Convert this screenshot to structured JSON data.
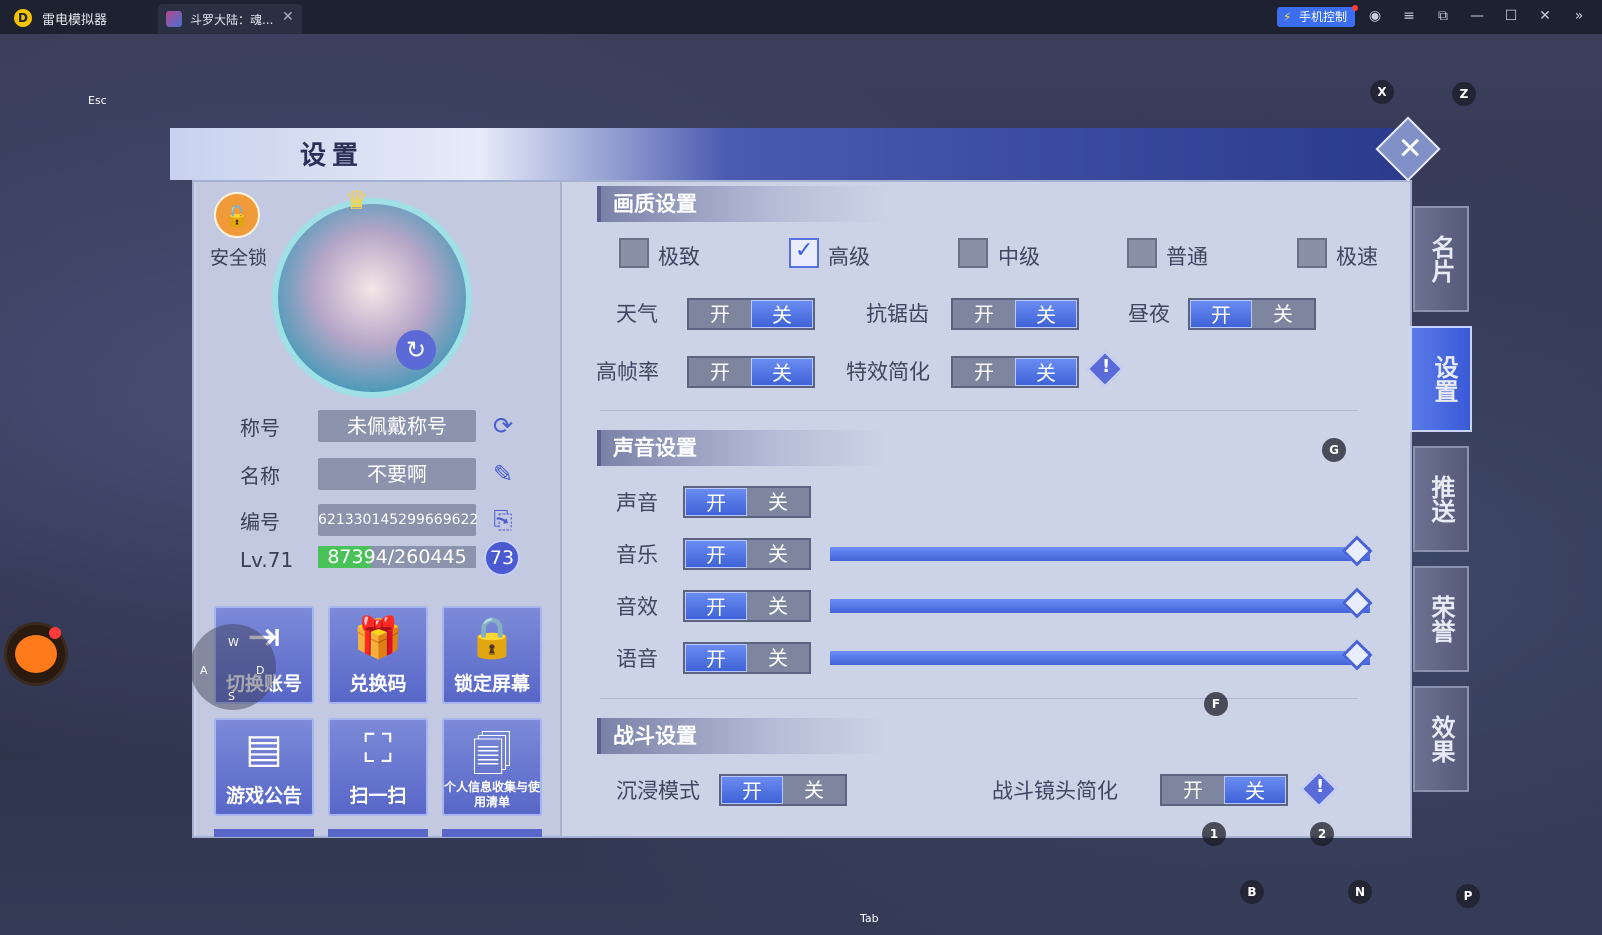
{
  "titlebar": {
    "app_name": "雷电模拟器",
    "tab_title": "斗罗大陆：魂...",
    "phone_control": "手机控制"
  },
  "keys": {
    "esc": "Esc",
    "x": "X",
    "z": "Z",
    "g": "G",
    "f": "F",
    "one": "1",
    "two": "2",
    "b": "B",
    "n": "N",
    "p": "P",
    "tab": "Tab",
    "w": "W",
    "a": "A",
    "d": "D",
    "s": "S"
  },
  "panel": {
    "title": "设置"
  },
  "profile": {
    "lock_label": "安全锁",
    "title_label": "称号",
    "title_value": "未佩戴称号",
    "name_label": "名称",
    "name_value": "不要啊",
    "id_label": "编号",
    "id_value": "621330145299669622",
    "level_label": "Lv.71",
    "exp_text": "87394/260445",
    "exp_progress": 0.3356,
    "level_badge": "73",
    "tiles": [
      {
        "label": "切换账号"
      },
      {
        "label": "兑换码"
      },
      {
        "label": "锁定屏幕"
      },
      {
        "label": "游戏公告"
      },
      {
        "label": "扫一扫"
      },
      {
        "label": "个人信息收集与使用清单"
      }
    ]
  },
  "graphics": {
    "title": "画质设置",
    "options": [
      {
        "label": "极致",
        "checked": false
      },
      {
        "label": "高级",
        "checked": true
      },
      {
        "label": "中级",
        "checked": false
      },
      {
        "label": "普通",
        "checked": false
      },
      {
        "label": "极速",
        "checked": false
      }
    ],
    "weather_label": "天气",
    "antialias_label": "抗锯齿",
    "daynight_label": "昼夜",
    "highfps_label": "高帧率",
    "effects_label": "特效简化"
  },
  "sound": {
    "title": "声音设置",
    "sound_label": "声音",
    "music_label": "音乐",
    "music_level": 1.0,
    "sfx_label": "音效",
    "sfx_level": 1.0,
    "voice_label": "语音",
    "voice_level": 1.0
  },
  "battle": {
    "title": "战斗设置",
    "immersive_label": "沉浸模式",
    "camera_label": "战斗镜头简化"
  },
  "toggle": {
    "on": "开",
    "off": "关"
  },
  "side_tabs": [
    "名片",
    "设置",
    "推送",
    "荣誉",
    "效果"
  ],
  "colors": {
    "accent": "#3f62d8",
    "exp": "#49c25a",
    "lock": "#f19a3a"
  }
}
